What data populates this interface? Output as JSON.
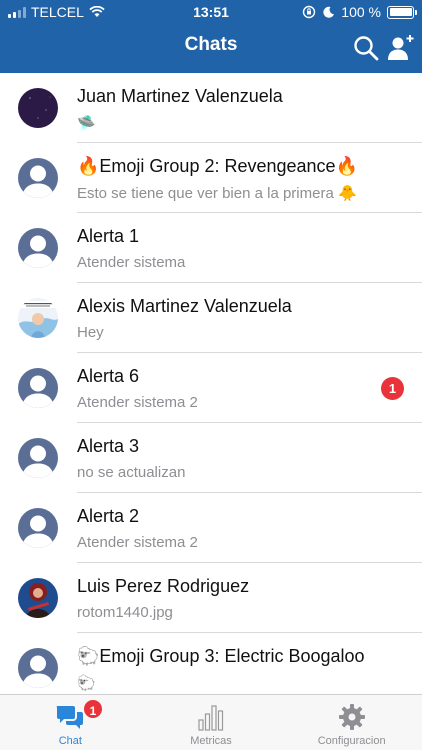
{
  "status_bar": {
    "carrier": "TELCEL",
    "time": "13:51",
    "battery": "100 %",
    "battery_level": 1.0
  },
  "header": {
    "title": "Chats",
    "search_icon": "search-icon",
    "add_user_icon": "add-user-icon"
  },
  "chats": [
    {
      "name": "Juan Martinez Valenzuela",
      "preview": "🛸",
      "avatar": "photo-dark",
      "unread": ""
    },
    {
      "name": "🔥Emoji Group 2: Revengeance🔥",
      "preview": "Esto se tiene que ver bien a la primera 🐥",
      "avatar": "default",
      "unread": ""
    },
    {
      "name": "Alerta 1",
      "preview": "Atender sistema",
      "avatar": "default",
      "unread": ""
    },
    {
      "name": "Alexis Martinez Valenzuela",
      "preview": "Hey",
      "avatar": "photo-light",
      "unread": ""
    },
    {
      "name": "Alerta 6",
      "preview": "Atender sistema 2",
      "avatar": "default",
      "unread": "1"
    },
    {
      "name": "Alerta 3",
      "preview": "no se actualizan",
      "avatar": "default",
      "unread": ""
    },
    {
      "name": "Alerta 2",
      "preview": "Atender sistema 2",
      "avatar": "default",
      "unread": ""
    },
    {
      "name": "Luis Perez Rodriguez",
      "preview": "rotom1440.jpg",
      "avatar": "photo-red",
      "unread": ""
    },
    {
      "name": "🐑Emoji Group 3: Electric Boogaloo",
      "preview": "🐑",
      "avatar": "default",
      "unread": ""
    }
  ],
  "tabbar": {
    "tabs": [
      {
        "label": "Chat",
        "icon": "chat-bubbles-icon",
        "badge": "1",
        "active": true
      },
      {
        "label": "Metricas",
        "icon": "bar-chart-icon",
        "active": false
      },
      {
        "label": "Configuracion",
        "icon": "gear-icon",
        "active": false
      }
    ]
  },
  "colors": {
    "header_bg": "#2163a9",
    "badge": "#e8333a",
    "active_tab": "#2a86d8",
    "avatar_default": "#5a6e96"
  }
}
